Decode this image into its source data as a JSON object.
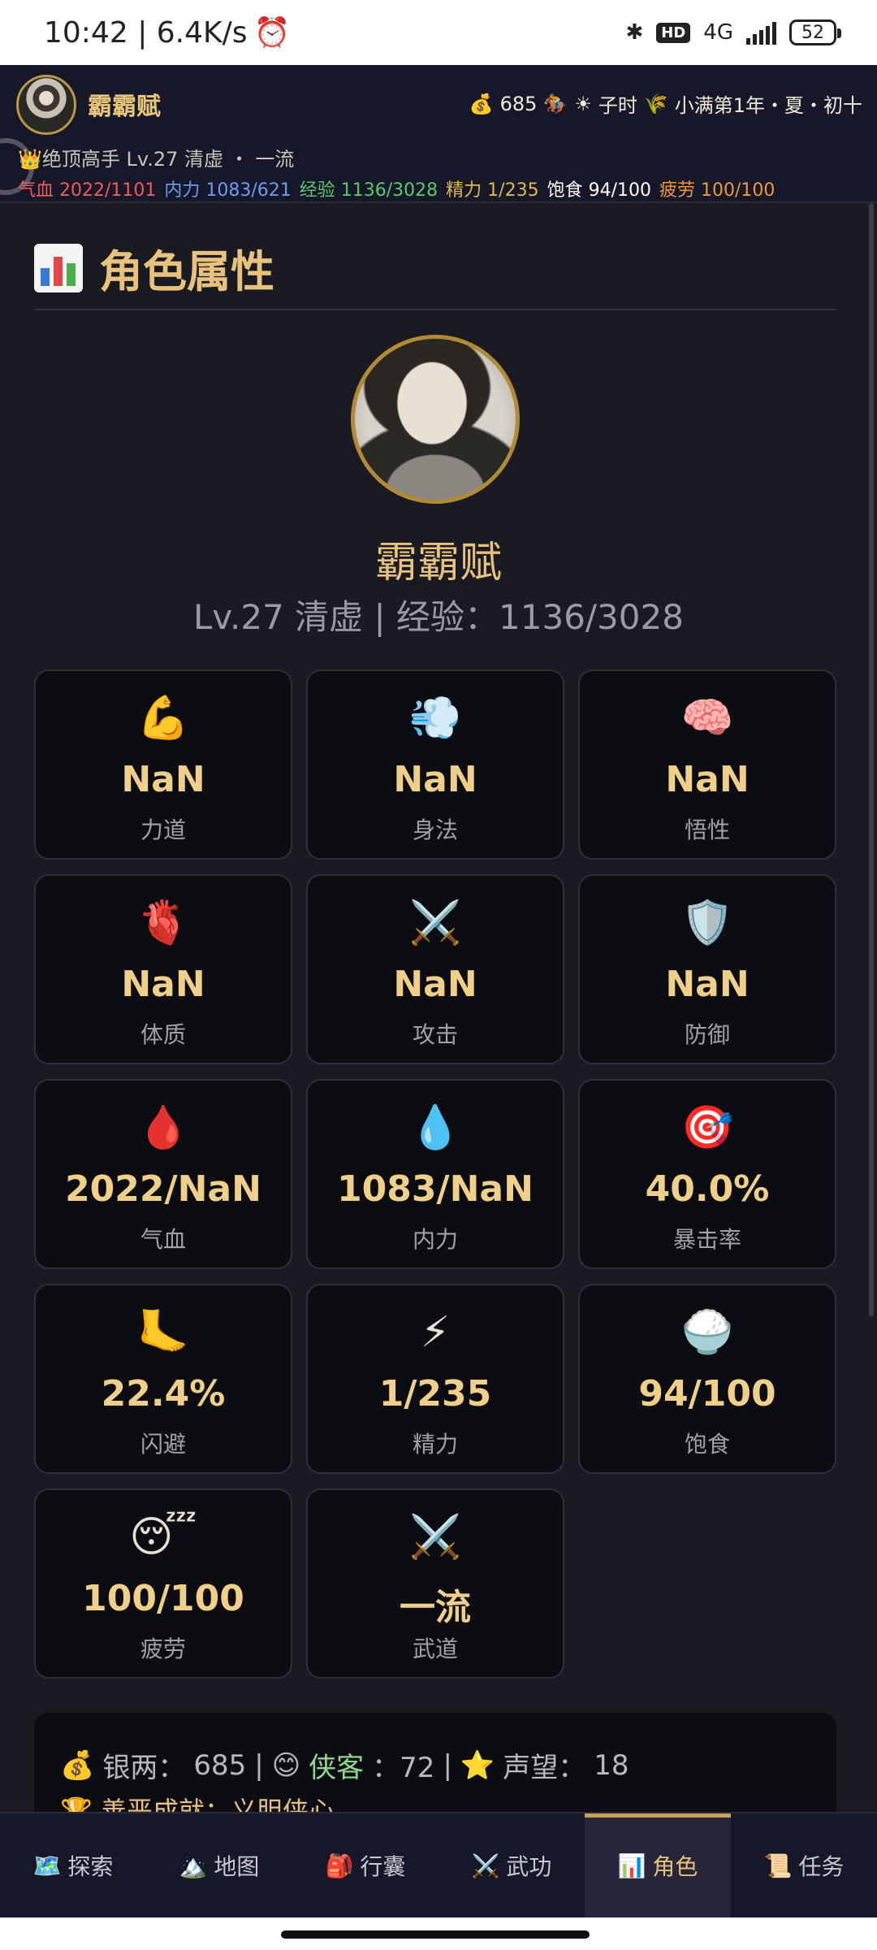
{
  "status_bar": {
    "time_speed": "10:42 | 6.4K/s",
    "alarm_icon": "alarm-icon",
    "bluetooth_icon": "bluetooth-icon",
    "hd_badge": "HD",
    "network": "4G",
    "battery": "52"
  },
  "header": {
    "player_name": "霸霸赋",
    "money": "685",
    "time_label": "子时",
    "date_label": "小满第1年・夏・初十",
    "title_line": "绝顶高手 Lv.27 清虚 ・ 一流",
    "stats": {
      "hp": "气血 2022/1101",
      "mp": "内力 1083/621",
      "exp": "经验 1136/3028",
      "energy": "精力 1/235",
      "food": "饱食 94/100",
      "fatigue": "疲劳 100/100"
    }
  },
  "panel": {
    "section_title": "角色属性",
    "char_name": "霸霸赋",
    "char_level": "Lv.27 清虚 | 经验：1136/3028",
    "cards": [
      {
        "icon": "💪",
        "value": "NaN",
        "label": "力道"
      },
      {
        "icon": "💨",
        "value": "NaN",
        "label": "身法"
      },
      {
        "icon": "🧠",
        "value": "NaN",
        "label": "悟性"
      },
      {
        "icon": "🫀",
        "value": "NaN",
        "label": "体质"
      },
      {
        "icon": "⚔️",
        "value": "NaN",
        "label": "攻击"
      },
      {
        "icon": "🛡️",
        "value": "NaN",
        "label": "防御"
      },
      {
        "icon": "🩸",
        "value": "2022/NaN",
        "label": "气血"
      },
      {
        "icon": "💧",
        "value": "1083/NaN",
        "label": "内力"
      },
      {
        "icon": "🎯",
        "value": "40.0%",
        "label": "暴击率"
      },
      {
        "icon": "🦶",
        "value": "22.4%",
        "label": "闪避"
      },
      {
        "icon": "⚡",
        "value": "1/235",
        "label": "精力"
      },
      {
        "icon": "🍚",
        "value": "94/100",
        "label": "饱食"
      },
      {
        "icon": "😴",
        "value": "100/100",
        "label": "疲劳"
      },
      {
        "icon": "⚔️",
        "value": "一流",
        "label": "武道"
      }
    ],
    "summary": {
      "silver_label": "银两：",
      "silver_value": "685",
      "xiake_label": "侠客",
      "xiake_value": "：72",
      "fame_label": "声望：",
      "fame_value": "18",
      "achievement": "善恶成就：义胆侠心"
    }
  },
  "bottom_nav": [
    {
      "icon": "🗺️",
      "label": "探索"
    },
    {
      "icon": "🏔️",
      "label": "地图"
    },
    {
      "icon": "🎒",
      "label": "行囊"
    },
    {
      "icon": "⚔️",
      "label": "武功"
    },
    {
      "icon": "📊",
      "label": "角色",
      "active": true
    },
    {
      "icon": "📜",
      "label": "任务"
    }
  ]
}
